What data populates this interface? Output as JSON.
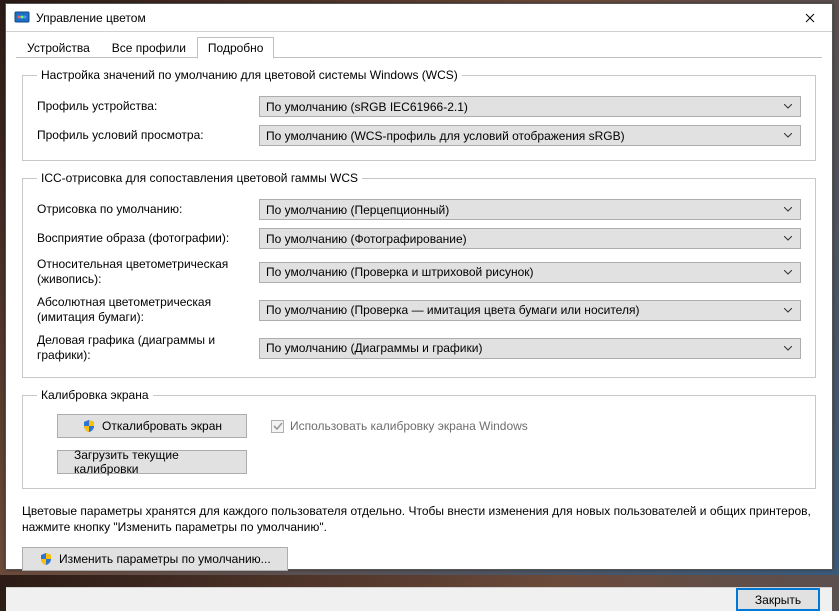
{
  "title": "Управление цветом",
  "tabs": {
    "devices": "Устройства",
    "allprofiles": "Все профили",
    "advanced": "Подробно"
  },
  "group_wcs": {
    "legend": "Настройка значений по умолчанию для цветовой системы Windows (WCS)",
    "device_profile_label": "Профиль устройства:",
    "device_profile_value": "По умолчанию (sRGB IEC61966-2.1)",
    "viewing_label": "Профиль условий просмотра:",
    "viewing_value": "По умолчанию (WCS-профиль для условий отображения sRGB)"
  },
  "group_icc": {
    "legend": "ICC-отрисовка для сопоставления цветовой гаммы WCS",
    "default_intent_label": "Отрисовка по умолчанию:",
    "default_intent_value": "По умолчанию (Перцепционный)",
    "perceptual_label": "Восприятие образа (фотографии):",
    "perceptual_value": "По умолчанию (Фотографирование)",
    "rel_colorimetric_label": "Относительная цветометрическая (живопись):",
    "rel_colorimetric_value": "По умолчанию (Проверка и штриховой рисунок)",
    "abs_colorimetric_label": "Абсолютная цветометрическая (имитация бумаги):",
    "abs_colorimetric_value": "По умолчанию (Проверка — имитация цвета бумаги или носителя)",
    "business_label": "Деловая графика (диаграммы и графики):",
    "business_value": "По умолчанию (Диаграммы и графики)"
  },
  "group_calib": {
    "legend": "Калибровка экрана",
    "calibrate_btn": "Откалибровать экран",
    "use_windows_calib": "Использовать калибровку экрана Windows",
    "load_btn": "Загрузить текущие калибровки"
  },
  "note_text": "Цветовые параметры хранятся для каждого пользователя отдельно. Чтобы внести изменения для новых пользователей и общих принтеров, нажмите кнопку \"Изменить параметры по умолчанию\".",
  "change_defaults_btn": "Изменить параметры по умолчанию...",
  "close_btn": "Закрыть"
}
